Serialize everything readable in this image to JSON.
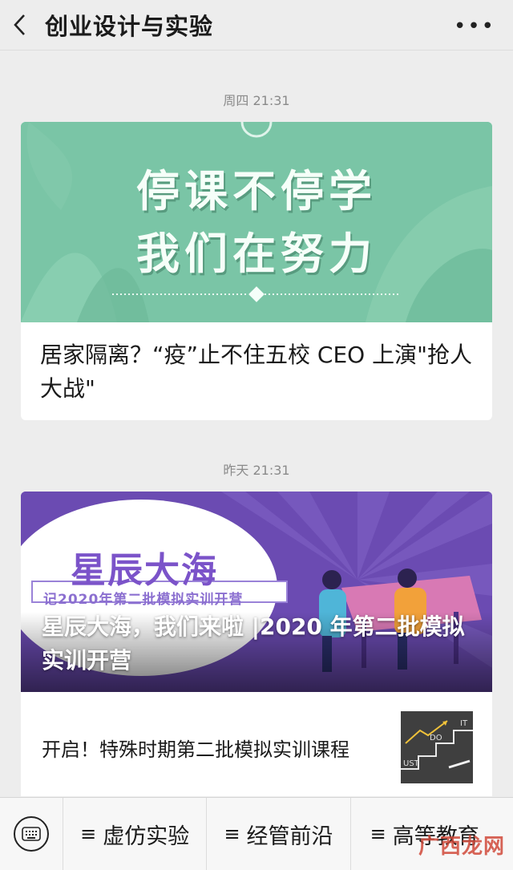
{
  "header": {
    "title": "创业设计与实验"
  },
  "feed": [
    {
      "timestamp": "周四 21:31",
      "cover": {
        "line1": "停课不停学",
        "line2": "我们在努力"
      },
      "headline": "居家隔离？“疫”止不住五校 CEO 上演\"抢人大战\""
    },
    {
      "timestamp": "昨天 21:31",
      "cover": {
        "brand": "星辰大海",
        "subtitle": "记2020年第二批模拟实训开营"
      },
      "headline": "星辰大海，我们来啦 |2020 年第二批模拟实训开营",
      "sub_items": [
        {
          "title": "开启！特殊时期第二批模拟实训课程"
        }
      ]
    }
  ],
  "bottom_menu": {
    "items": [
      "虚仿实验",
      "经管前沿",
      "高等教育"
    ]
  },
  "watermark": "广西龙网",
  "colors": {
    "green_cover": "#7ac5a6",
    "purple_cover": "#6a4ab0"
  }
}
